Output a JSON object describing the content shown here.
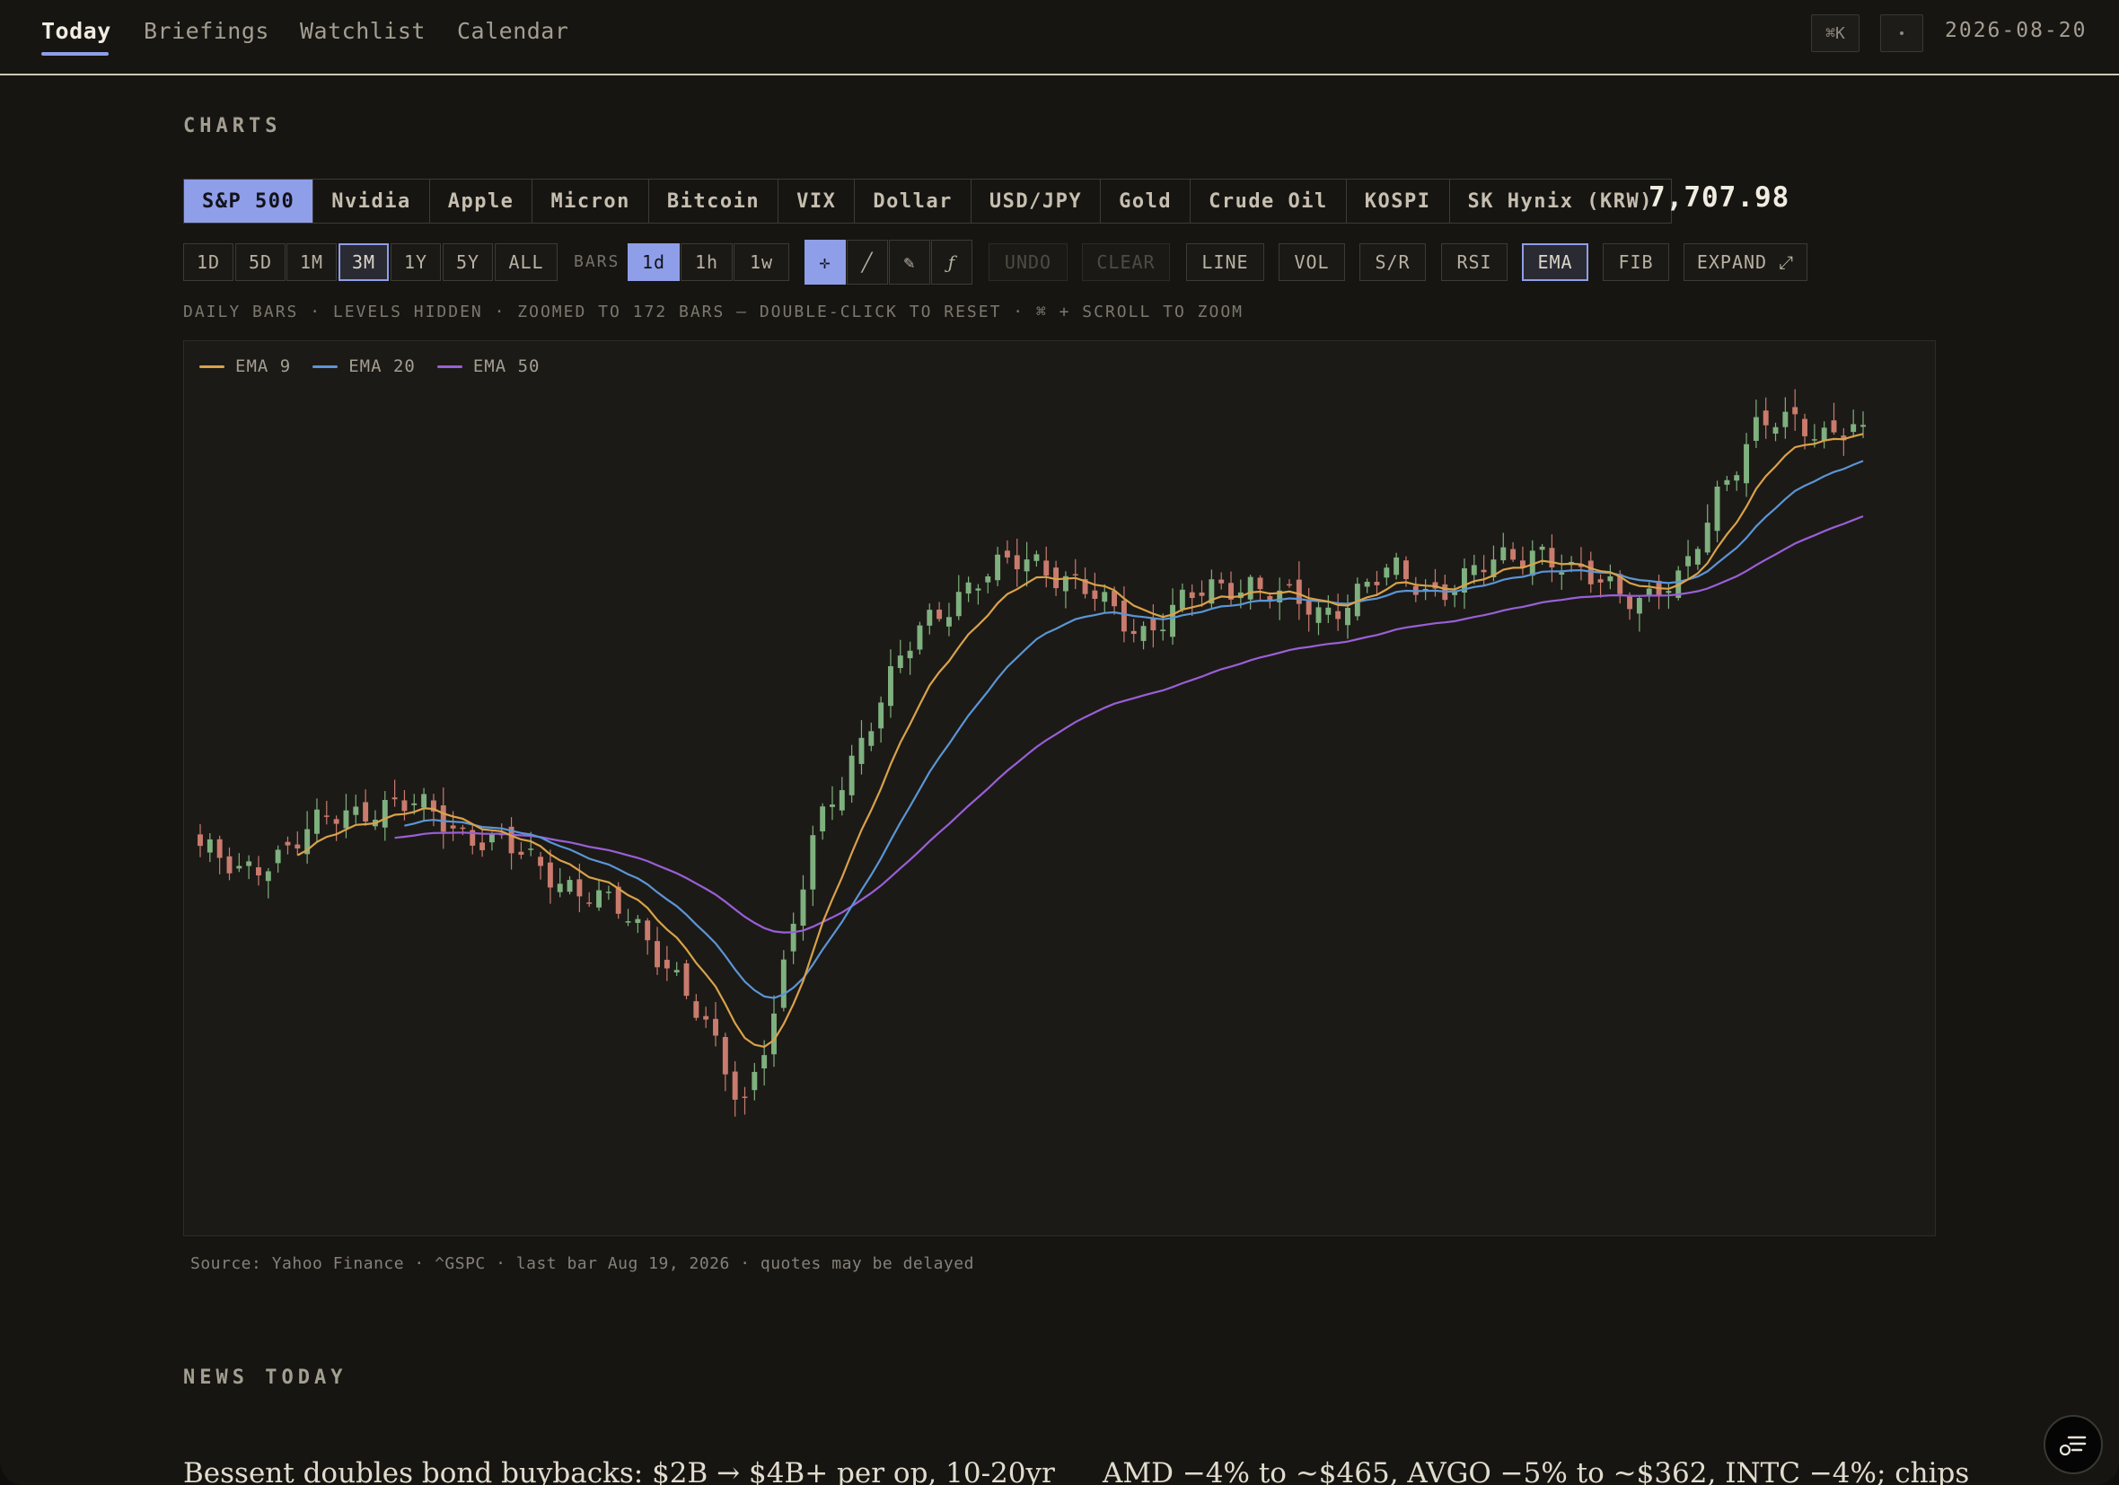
{
  "nav": {
    "tabs": [
      {
        "label": "Today",
        "active": true
      },
      {
        "label": "Briefings",
        "active": false
      },
      {
        "label": "Watchlist",
        "active": false
      },
      {
        "label": "Calendar",
        "active": false
      }
    ],
    "shortcut": "⌘K",
    "theme_icon": "sun-icon",
    "date": "2026-08-20"
  },
  "charts": {
    "section_title": "CHARTS",
    "assets": [
      "S&P 500",
      "Nvidia",
      "Apple",
      "Micron",
      "Bitcoin",
      "VIX",
      "Dollar",
      "USD/JPY",
      "Gold",
      "Crude Oil",
      "KOSPI",
      "SK Hynix (KRW)"
    ],
    "active_asset": "S&P 500",
    "price": "7,707.98",
    "ranges": [
      "1D",
      "5D",
      "1M",
      "3M",
      "1Y",
      "5Y",
      "ALL"
    ],
    "active_range": "3M",
    "bars_label": "BARS",
    "bar_sizes": [
      "1d",
      "1h",
      "1w"
    ],
    "active_bar": "1d",
    "tools": [
      "crosshair-icon",
      "line-tool-icon",
      "pencil-icon",
      "formula-icon"
    ],
    "tool_glyphs": [
      "✛",
      "╱",
      "✎",
      "ƒ"
    ],
    "undo": "UNDO",
    "clear": "CLEAR",
    "toggles": [
      "LINE",
      "VOL",
      "S/R",
      "RSI",
      "EMA",
      "FIB"
    ],
    "active_toggle": "EMA",
    "expand": "EXPAND ⤢",
    "hint": "DAILY BARS · LEVELS HIDDEN · ZOOMED TO 172 BARS — DOUBLE-CLICK TO RESET · ⌘ + SCROLL TO ZOOM",
    "source": "Source: Yahoo Finance · ^GSPC · last bar Aug 19, 2026 · quotes may be delayed"
  },
  "colors": {
    "accent": "#8f9ee8",
    "up": "#7fb07f",
    "down": "#c97b6e",
    "ema9": "#d9a24a",
    "ema20": "#5b95d6",
    "ema50": "#9a5fd8"
  },
  "chart_data": {
    "type": "candlestick",
    "title": "",
    "bar_count": 172,
    "y_approx_range": [
      6400,
      7760
    ],
    "last_close": 7707.98,
    "legend": [
      {
        "name": "EMA 9",
        "color": "#d9a24a"
      },
      {
        "name": "EMA 20",
        "color": "#5b95d6"
      },
      {
        "name": "EMA 50",
        "color": "#9a5fd8"
      }
    ],
    "close_path": [
      6975,
      6920,
      6960,
      7000,
      7030,
      7050,
      7040,
      7010,
      6985,
      6950,
      6920,
      6880,
      6840,
      6770,
      6650,
      6520,
      6720,
      6990,
      7130,
      7250,
      7360,
      7420,
      7450,
      7480,
      7440,
      7390,
      7350,
      7390,
      7420,
      7440,
      7400,
      7380,
      7420,
      7450,
      7420,
      7440,
      7470,
      7500,
      7440,
      7430,
      7410,
      7430,
      7600,
      7700,
      7710,
      7700,
      7708
    ]
  },
  "news": {
    "section_title": "NEWS TODAY",
    "headlines": [
      "Bessent doubles bond buybacks: $2B → $4B+ per op, 10-20yr",
      "AMD −4% to ~$465, AVGO −5% to ~$362, INTC −4%; chips"
    ]
  },
  "fab_icon": "menu-chat-icon"
}
